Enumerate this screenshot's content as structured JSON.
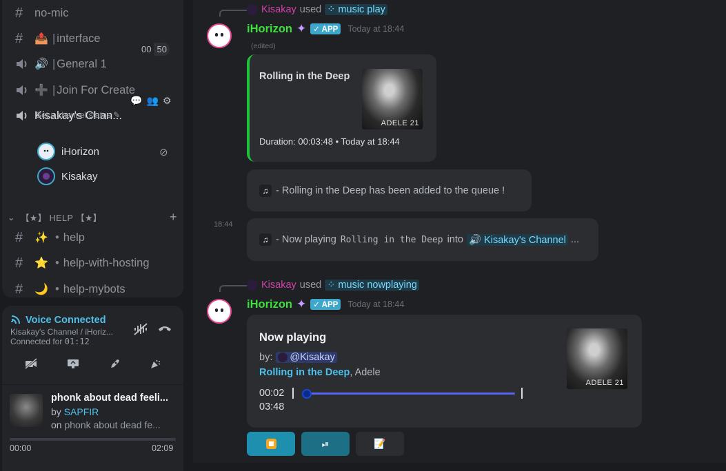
{
  "sidebar": {
    "channels": [
      {
        "kind": "text",
        "emoji": "",
        "label": "no-mic",
        "sep": ""
      },
      {
        "kind": "text",
        "emoji": "📤",
        "label": "interface",
        "sep": "|"
      },
      {
        "kind": "voice",
        "emoji": "🔊",
        "label": "General 1",
        "sep": "|"
      },
      {
        "kind": "voice",
        "emoji": "➕",
        "label": "Join For Create",
        "sep": "|"
      }
    ],
    "general_limit": {
      "current": "00",
      "max": "50"
    },
    "active_channel": {
      "label": "Kisakay's Chan...",
      "status": "Set a channel status"
    },
    "members": [
      {
        "name": "iHorizon"
      },
      {
        "name": "Kisakay"
      }
    ],
    "category": {
      "label": "【★】 HELP 【★】"
    },
    "help_channels": [
      {
        "emoji": "✨",
        "label": "help"
      },
      {
        "emoji": "⭐",
        "label": "help-with-hosting"
      },
      {
        "emoji": "🌙",
        "label": "help-mybots"
      }
    ],
    "voice": {
      "title": "Voice Connected",
      "channel_path": "Kisakay's Channel / iHoriz...",
      "connected_prefix": "Connected for",
      "connected_time": "01:12"
    },
    "now_playing": {
      "title": "phonk about dead feeli...",
      "by_prefix": "by",
      "artist": "SAPFIR",
      "on_prefix": "on",
      "album": "phonk about dead fe...",
      "elapsed": "00:00",
      "duration": "02:09",
      "progress": 0.0
    }
  },
  "chat": {
    "messages": [
      {
        "invoker": "Kisakay",
        "used": "used",
        "command": "music play",
        "bot_name": "iHorizon",
        "badge": "APP",
        "timestamp": "Today at 18:44",
        "edited": "(edited)",
        "embed": {
          "title": "Rolling in the Deep",
          "footer": "Duration: 00:03:48 • Today at 18:44",
          "cover_label": "ADELE 21"
        },
        "queue_line": "- Rolling in the Deep has been added to the queue !",
        "side_time": "18:44",
        "np_prefix": "- Now playing",
        "np_song": "Rolling in the Deep",
        "np_into": "into",
        "np_channel": "Kisakay's Channel",
        "np_more": "..."
      },
      {
        "invoker": "Kisakay",
        "used": "used",
        "command": "music nowplaying",
        "bot_name": "iHorizon",
        "badge": "APP",
        "timestamp": "Today at 18:44",
        "embed": {
          "title": "Now playing",
          "by_prefix": "by:",
          "requester": "@Kisakay",
          "song": "Rolling in the Deep",
          "artist": ", Adele",
          "current": "00:02",
          "total": "03:48",
          "progress": 0.01,
          "cover_label": "ADELE 21"
        }
      }
    ]
  }
}
